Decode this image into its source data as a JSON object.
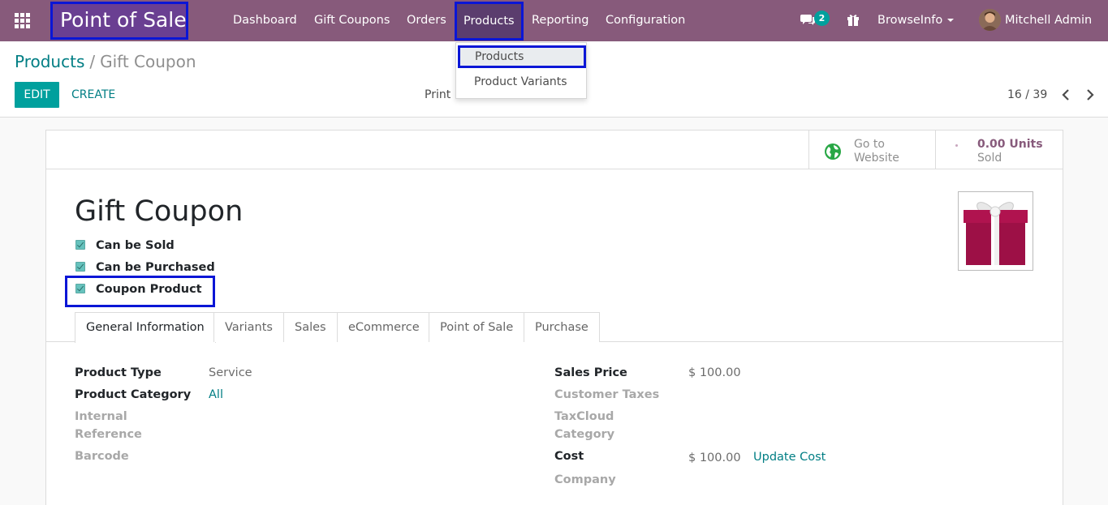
{
  "navbar": {
    "app_name": "Point of Sale",
    "menu": [
      "Dashboard",
      "Gift Coupons",
      "Orders",
      "Products",
      "Reporting",
      "Configuration"
    ],
    "chat_count": "2",
    "company": "BrowseInfo",
    "user": "Mitchell Admin"
  },
  "products_dropdown": {
    "items": [
      "Products",
      "Product Variants"
    ]
  },
  "breadcrumb": {
    "parent": "Products",
    "separator": "/",
    "current": "Gift Coupon"
  },
  "controls": {
    "edit": "EDIT",
    "create": "CREATE",
    "print": "Print",
    "pager": "16 / 39"
  },
  "stat_buttons": {
    "website_line1": "Go to",
    "website_line2": "Website",
    "units": "0.00 Units",
    "sold": "Sold"
  },
  "product": {
    "name": "Gift Coupon",
    "checkboxes": [
      "Can be Sold",
      "Can be Purchased",
      "Coupon Product"
    ]
  },
  "tabs": [
    "General Information",
    "Variants",
    "Sales",
    "eCommerce",
    "Point of Sale",
    "Purchase"
  ],
  "fields_left": {
    "product_type_label": "Product Type",
    "product_type_value": "Service",
    "category_label": "Product Category",
    "category_value": "All",
    "internal_ref_label_1": "Internal",
    "internal_ref_label_2": "Reference",
    "barcode_label": "Barcode"
  },
  "fields_right": {
    "sales_price_label": "Sales Price",
    "sales_price_value": "$ 100.00",
    "customer_taxes_label": "Customer Taxes",
    "taxcloud_label_1": "TaxCloud",
    "taxcloud_label_2": "Category",
    "cost_label": "Cost",
    "cost_value": "$ 100.00",
    "update_cost": "Update Cost",
    "company_label": "Company"
  },
  "colors": {
    "navbar": "#875a7b",
    "accent": "#00a09d",
    "link": "#017e84",
    "highlight": "#0a16d6"
  }
}
